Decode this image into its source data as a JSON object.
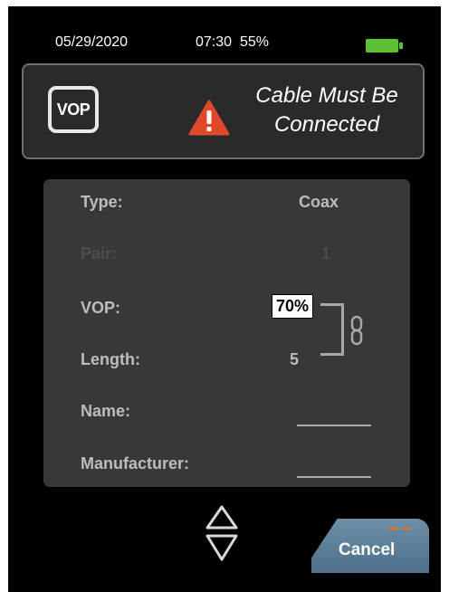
{
  "status_bar": {
    "date": "05/29/2020",
    "time": "07:30",
    "battery_percent": "55%",
    "battery_icon": "battery-icon",
    "battery_color": "#5cc234"
  },
  "banner": {
    "icon_label": "VOP",
    "warning_icon": "warning-triangle-icon",
    "warning_color": "#e0482b",
    "message_line1": "Cable Must Be",
    "message_line2": "Connected"
  },
  "settings": {
    "type_label": "Type:",
    "type_value": "Coax",
    "pair_label": "Pair:",
    "pair_value": "1",
    "vop_label": "VOP:",
    "vop_value": "70%",
    "length_label": "Length:",
    "length_value": "5",
    "link_icon": "link-chain-icon",
    "name_label": "Name:",
    "name_value": "",
    "manufacturer_label": "Manufacturer:",
    "manufacturer_value": ""
  },
  "controls": {
    "scroll_icon": "up-down-arrows-icon",
    "cancel_label": "Cancel",
    "cancel_color": "#5a7c97"
  }
}
